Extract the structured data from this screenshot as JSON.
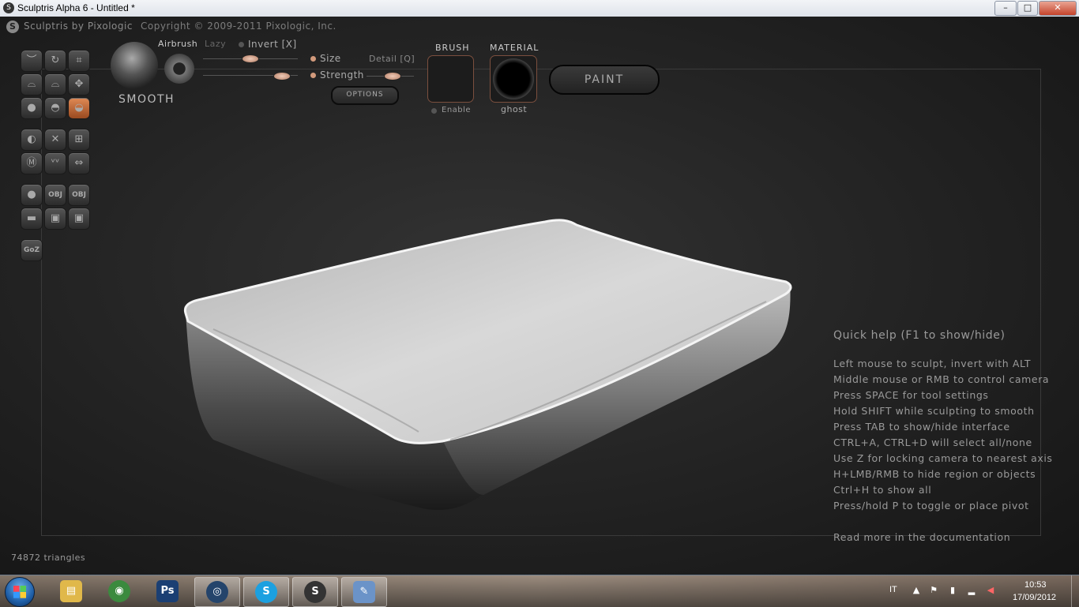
{
  "window": {
    "title": "Sculptris Alpha 6 - Untitled *",
    "minimize": "–",
    "maximize": "□",
    "close": "✕"
  },
  "header": {
    "brand": "Sculptris by Pixologic",
    "copyright": "Copyright © 2009-2011 Pixologic, Inc."
  },
  "toolbar": {
    "goz_label": "GoZ",
    "obj_label": "OBJ"
  },
  "brush_settings": {
    "mode_label": "SMOOTH",
    "airbrush_label": "Airbrush",
    "lazy_label": "Lazy",
    "invert_label": "Invert [X]",
    "size_label": "Size",
    "strength_label": "Strength",
    "detail_label": "Detail [Q]",
    "options_label": "OPTIONS"
  },
  "brush_panel": {
    "title": "BRUSH",
    "enable_label": "Enable"
  },
  "material_panel": {
    "title": "MATERIAL",
    "material_name": "ghost"
  },
  "paint_label": "PAINT",
  "quick_help": {
    "title": "Quick help (F1 to show/hide)",
    "lines": [
      "Left mouse to sculpt, invert with ALT",
      "Middle mouse or RMB to control camera",
      "Press SPACE for tool settings",
      "Hold SHIFT while sculpting to smooth",
      "Press TAB to show/hide interface",
      "CTRL+A, CTRL+D will select all/none",
      "Use Z for locking camera to nearest axis",
      "H+LMB/RMB to hide region or objects",
      "Ctrl+H to show all",
      "Press/hold P to toggle or place pivot"
    ],
    "more": "Read more in the documentation"
  },
  "status": {
    "triangles": "74872 triangles"
  },
  "taskbar": {
    "apps": [
      {
        "name": "explorer",
        "glyph": "▤",
        "color": "#e0b84a"
      },
      {
        "name": "chrome",
        "glyph": "◉",
        "color": "#3b8a3e"
      },
      {
        "name": "photoshop",
        "glyph": "Ps",
        "color": "#1b3f73"
      },
      {
        "name": "cinema4d",
        "glyph": "◎",
        "color": "#24446b"
      },
      {
        "name": "skype",
        "glyph": "S",
        "color": "#1ca0e0"
      },
      {
        "name": "sculptris",
        "glyph": "S",
        "color": "#333333"
      },
      {
        "name": "paint",
        "glyph": "✎",
        "color": "#6b93c8"
      }
    ],
    "language": "IT",
    "time": "10:53",
    "date": "17/09/2012"
  },
  "colors": {
    "accent": "#d0875a",
    "background": "#1e1e1e",
    "text": "#9a9a9a"
  }
}
